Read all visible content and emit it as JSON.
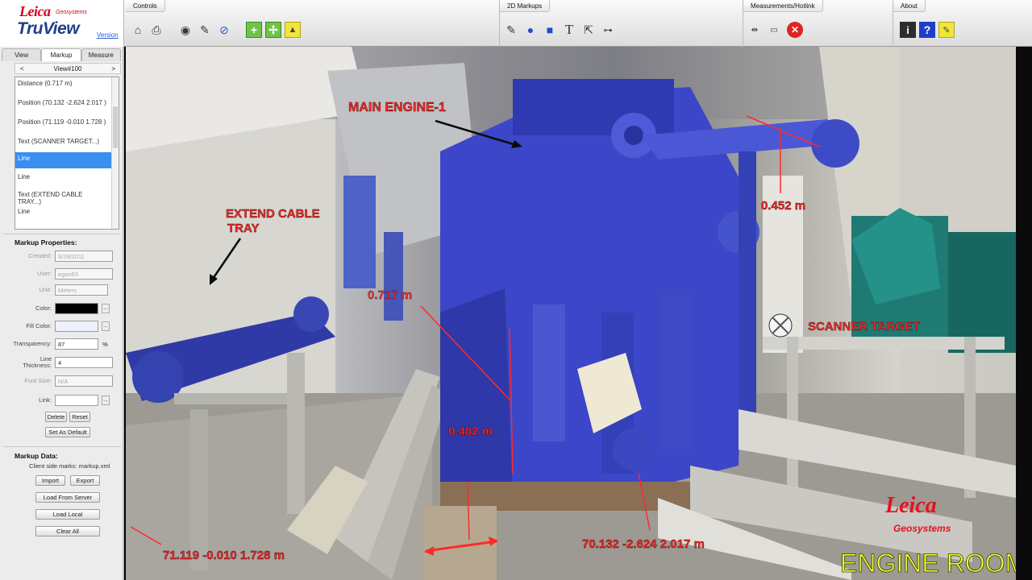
{
  "app": {
    "brand": "Leica",
    "brand_sub": "Geosystems",
    "product": "TruView",
    "version_link": "Version"
  },
  "toolbar": {
    "controls": {
      "title": "Controls",
      "icons": [
        "home-icon",
        "print-icon",
        "eye-icon",
        "edit-icon",
        "navigate-icon",
        "zoom-in-icon",
        "zoom-fit-icon",
        "lock-icon"
      ]
    },
    "markups_2d": {
      "title": "2D Markups",
      "icons": [
        "pen-icon",
        "ellipse-icon",
        "rectangle-icon",
        "text-icon",
        "link-icon",
        "point-icon"
      ]
    },
    "measurements": {
      "title": "Measurements/Hotlink",
      "icons": [
        "distance-icon",
        "measure-icon",
        "clear-icon"
      ]
    },
    "about": {
      "title": "About",
      "icons": [
        "info-icon",
        "help-icon",
        "note-icon"
      ]
    }
  },
  "sidebar": {
    "tabs": [
      {
        "label": "View"
      },
      {
        "label": "Markup"
      },
      {
        "label": "Measure"
      }
    ],
    "view_nav": {
      "prev": "<",
      "label": "View#100",
      "next": ">"
    },
    "markups": [
      {
        "label": "Distance (0.717 m)"
      },
      {
        "label": "Position (70.132 -2.624 2.017 )"
      },
      {
        "label": "Position (71.119 -0.010 1.728 )"
      },
      {
        "label": "Text (SCANNER TARGET...)"
      },
      {
        "label": "Line"
      },
      {
        "label": "Line"
      },
      {
        "label": "Text (EXTEND CABLE\nTRAY...)"
      },
      {
        "label": "Line"
      }
    ],
    "properties": {
      "title": "Markup Properties:",
      "created_label": "Created:",
      "created_value": "6/29/2011",
      "user_label": "User:",
      "user_value": "egan63",
      "unit_label": "Unit:",
      "unit_value": "Meters",
      "color_label": "Color:",
      "fill_label": "Fill Color:",
      "transparency_label": "Transparency:",
      "transparency_value": "87",
      "transparency_unit": "%",
      "thickness_label": "Line\nThickness:",
      "thickness_value": "4",
      "fontsize_label": "Font Size:",
      "fontsize_value": "N/A",
      "link_label": "Link:",
      "link_value": "",
      "delete": "Delete",
      "reset": "Reset",
      "set_default": "Set As Default"
    },
    "markup_data": {
      "title": "Markup Data:",
      "client_marks": "Client side marks: markup.xml",
      "import": "Import",
      "export": "Export",
      "load_server": "Load From Server",
      "load_local": "Load Local",
      "clear_all": "Clear All"
    }
  },
  "scene": {
    "labels": {
      "main_engine": "MAIN ENGINE-1",
      "extend_cable": "EXTEND CABLE",
      "tray": "TRAY",
      "dist_0717": "0.717 m",
      "dist_0452": "0.452 m",
      "dist_0482": "0.482 m",
      "scanner_target": "SCANNER TARGET",
      "pos_left": "71.119 -0.010 1.728 m",
      "pos_right": "70.132 -2.624 2.017 m",
      "engine_room": "ENGINE ROOM",
      "leica_brand": "Leica",
      "leica_sub": "Geosystems"
    },
    "colors": {
      "markup_red": "#ff2a2a",
      "engine_blue": "#3b46c9",
      "caption_yellow": "#e9ff3a"
    }
  }
}
